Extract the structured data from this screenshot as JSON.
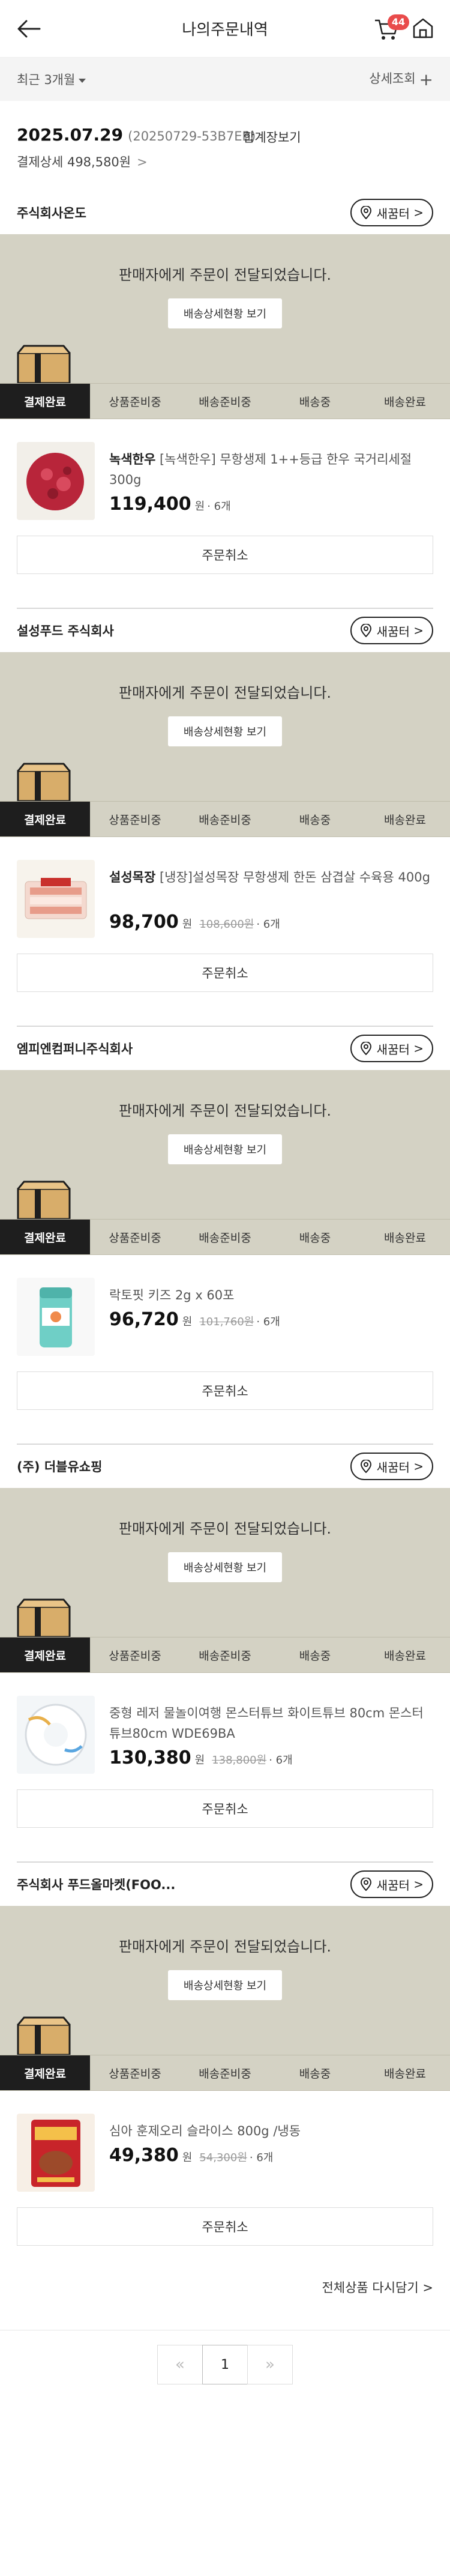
{
  "header": {
    "title": "나의주문내역",
    "cart_count": "44"
  },
  "filter": {
    "period": "최근 3개월",
    "detail_search": "상세조회"
  },
  "order": {
    "date": "2025.07.29",
    "order_no": "(20250729-53B7EB)",
    "receipt": "합계장보기",
    "detail": "결제상세 498,580원"
  },
  "banner": {
    "message": "판매자에게 주문이 전달되었습니다.",
    "button": "배송상세현황 보기"
  },
  "shop_button": "새꿈터",
  "steps": [
    "결제완료",
    "상품준비중",
    "배송준비중",
    "배송중",
    "배송완료"
  ],
  "cancel_label": "주문취소",
  "sellers": [
    {
      "name": "주식회사온도",
      "brand": "녹색한우",
      "desc": "[녹색한우] 무항생제 1++등급 한우 국거리세절 300g",
      "price": "119,400",
      "orig": "",
      "qty": "· 6개"
    },
    {
      "name": "설성푸드 주식회사",
      "brand": "설성목장",
      "desc": "[냉장]설성목장 무항생제 한돈 삼겹살 수육용 400g",
      "price": "98,700",
      "orig": "108,600원",
      "qty": "· 6개"
    },
    {
      "name": "엠피엔컴퍼니주식회사",
      "brand": "",
      "desc": "락토핏 키즈 2g x 60포",
      "price": "96,720",
      "orig": "101,760원",
      "qty": "· 6개"
    },
    {
      "name": "(주) 더블유쇼핑",
      "brand": "",
      "desc": "중형 레저 물놀이여행 몬스터튜브 화이트튜브 80cm 몬스터튜브80cm WDE69BA",
      "price": "130,380",
      "orig": "138,800원",
      "qty": "· 6개"
    },
    {
      "name": "주식회사 푸드올마켓(FOO...",
      "brand": "",
      "desc": "심아 훈제오리 슬라이스 800g /냉동",
      "price": "49,380",
      "orig": "54,300원",
      "qty": "· 6개"
    }
  ],
  "price_unit": "원",
  "reorder": "전체상품 다시담기",
  "pager": {
    "current": "1"
  }
}
